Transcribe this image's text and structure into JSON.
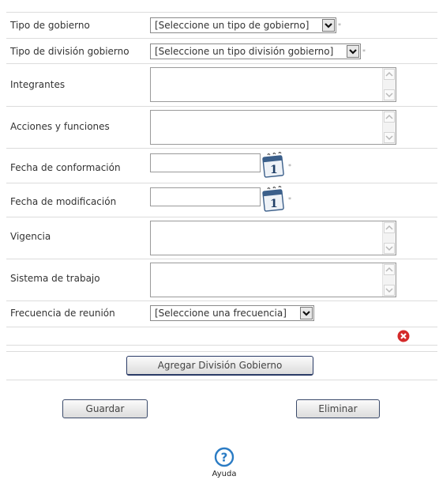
{
  "form": {
    "tipo_gobierno": {
      "label": "Tipo de gobierno",
      "value": "[Seleccione un tipo de gobierno]"
    },
    "tipo_division": {
      "label": "Tipo de división gobierno",
      "value": "[Seleccione un tipo división gobierno]"
    },
    "integrantes": {
      "label": "Integrantes",
      "value": ""
    },
    "acciones": {
      "label": "Acciones y funciones",
      "value": ""
    },
    "fecha_conformacion": {
      "label": "Fecha de conformación",
      "value": ""
    },
    "fecha_modificacion": {
      "label": "Fecha de modificación",
      "value": ""
    },
    "vigencia": {
      "label": "Vigencia",
      "value": ""
    },
    "sistema_trabajo": {
      "label": "Sistema de trabajo",
      "value": ""
    },
    "frecuencia": {
      "label": "Frecuencia de reunión",
      "value": "[Seleccione una frecuencia]"
    },
    "required_mark": "*",
    "calendar_day": "1"
  },
  "buttons": {
    "agregar": "Agregar División Gobierno",
    "guardar": "Guardar",
    "eliminar": "Eliminar"
  },
  "help": {
    "label": "Ayuda",
    "glyph": "?"
  },
  "icons": {
    "delete": "delete-x-icon",
    "calendar": "calendar-icon",
    "help": "help-icon",
    "dropdown": "chevron-down-icon"
  },
  "colors": {
    "delete_red": "#d42a2a",
    "help_blue": "#2a7bc4",
    "border": "#dcdcdc"
  }
}
